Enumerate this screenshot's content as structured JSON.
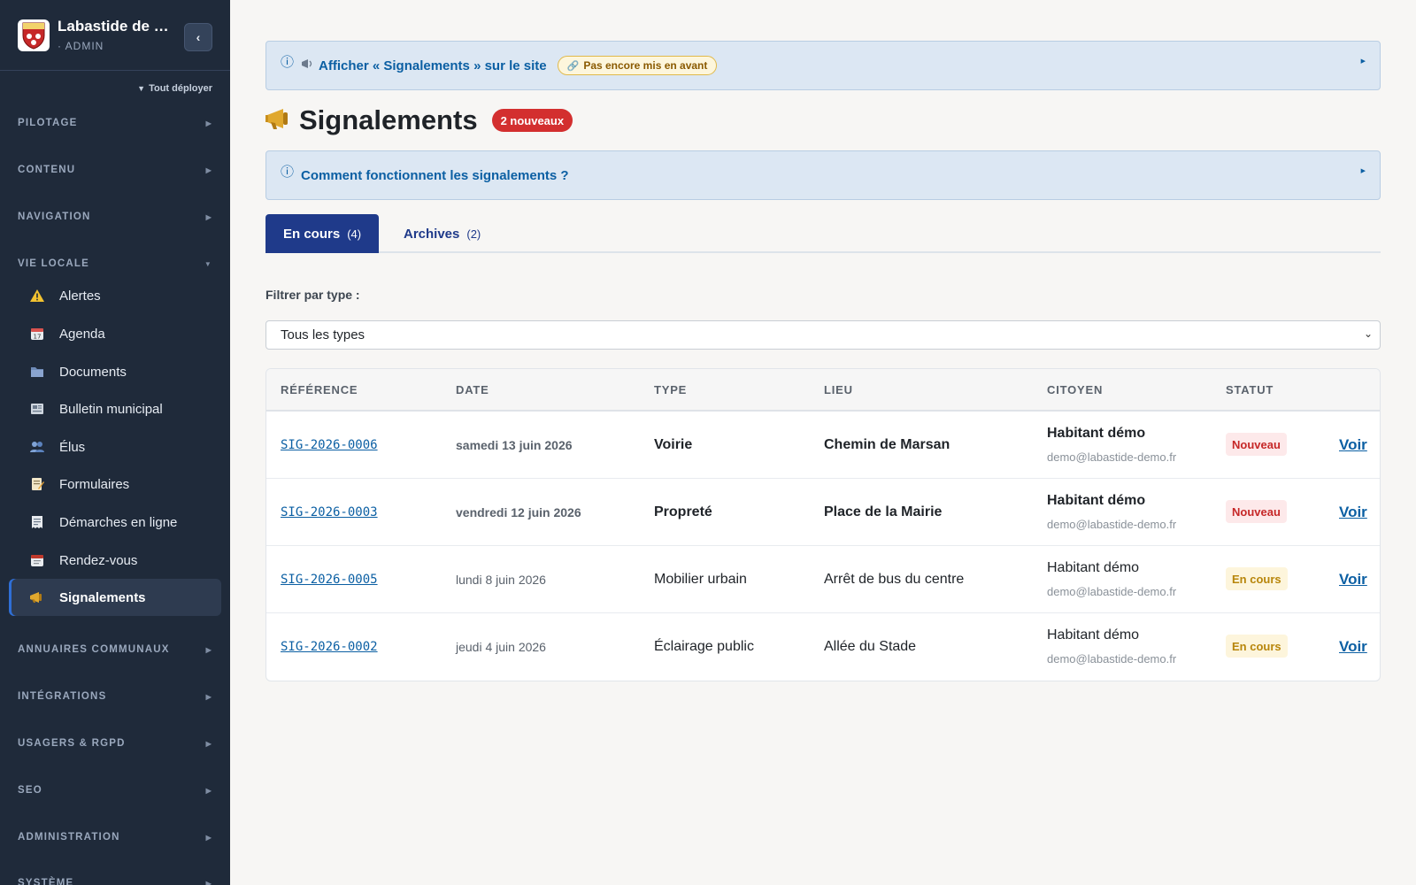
{
  "colors": {
    "sidebar_bg": "#1f2a3a",
    "accent": "#1f3a8a",
    "link": "#0b5fa3",
    "new_badge": "#d32f2f",
    "in_progress": "#b8860b"
  },
  "sidebar": {
    "brand_name": "Labastide de M...",
    "brand_role": "· ADMIN",
    "collapse_icon": "chevron-left-icon",
    "expand_all_label": "Tout déployer",
    "sections": {
      "pilotage": "PILOTAGE",
      "contenu": "CONTENU",
      "navigation": "NAVIGATION",
      "vie_locale": "VIE LOCALE",
      "annuaires": "ANNUAIRES COMMUNAUX",
      "integrations": "INTÉGRATIONS",
      "usagers": "USAGERS & RGPD",
      "seo": "SEO",
      "administration": "ADMINISTRATION",
      "systeme": "SYSTÈME"
    },
    "vie_locale_items": [
      {
        "label": "Alertes",
        "icon": "warning-icon"
      },
      {
        "label": "Agenda",
        "icon": "calendar-icon"
      },
      {
        "label": "Documents",
        "icon": "folder-icon"
      },
      {
        "label": "Bulletin municipal",
        "icon": "newspaper-icon"
      },
      {
        "label": "Élus",
        "icon": "people-icon"
      },
      {
        "label": "Formulaires",
        "icon": "memo-icon"
      },
      {
        "label": "Démarches en ligne",
        "icon": "receipt-icon"
      },
      {
        "label": "Rendez-vous",
        "icon": "tear-calendar-icon"
      },
      {
        "label": "Signalements",
        "icon": "megaphone-icon",
        "active": true
      }
    ]
  },
  "banner": {
    "link_text": "Afficher « Signalements » sur le site",
    "status_pill": "Pas encore mis en avant"
  },
  "page": {
    "title": "Signalements",
    "new_badge": "2 nouveaux",
    "help_link": "Comment fonctionnent les signalements ?"
  },
  "tabs": [
    {
      "label": "En cours",
      "count": "(4)",
      "active": true
    },
    {
      "label": "Archives",
      "count": "(2)",
      "active": false
    }
  ],
  "filter": {
    "label": "Filtrer par type :",
    "selected": "Tous les types"
  },
  "table": {
    "headers": [
      "RÉFÉRENCE",
      "DATE",
      "TYPE",
      "LIEU",
      "CITOYEN",
      "STATUT"
    ],
    "rows": [
      {
        "ref": "SIG-2026-0006",
        "date": "samedi 13 juin 2026",
        "type": "Voirie",
        "lieu": "Chemin de Marsan",
        "citizen": "Habitant démo",
        "email": "demo@labastide-demo.fr",
        "status": "Nouveau",
        "action": "Voir"
      },
      {
        "ref": "SIG-2026-0003",
        "date": "vendredi 12 juin 2026",
        "type": "Propreté",
        "lieu": "Place de la Mairie",
        "citizen": "Habitant démo",
        "email": "demo@labastide-demo.fr",
        "status": "Nouveau",
        "action": "Voir"
      },
      {
        "ref": "SIG-2026-0005",
        "date": "lundi 8 juin 2026",
        "type": "Mobilier urbain",
        "lieu": "Arrêt de bus du centre",
        "citizen": "Habitant démo",
        "email": "demo@labastide-demo.fr",
        "status": "En cours",
        "action": "Voir"
      },
      {
        "ref": "SIG-2026-0002",
        "date": "jeudi 4 juin 2026",
        "type": "Éclairage public",
        "lieu": "Allée du Stade",
        "citizen": "Habitant démo",
        "email": "demo@labastide-demo.fr",
        "status": "En cours",
        "action": "Voir"
      }
    ]
  }
}
